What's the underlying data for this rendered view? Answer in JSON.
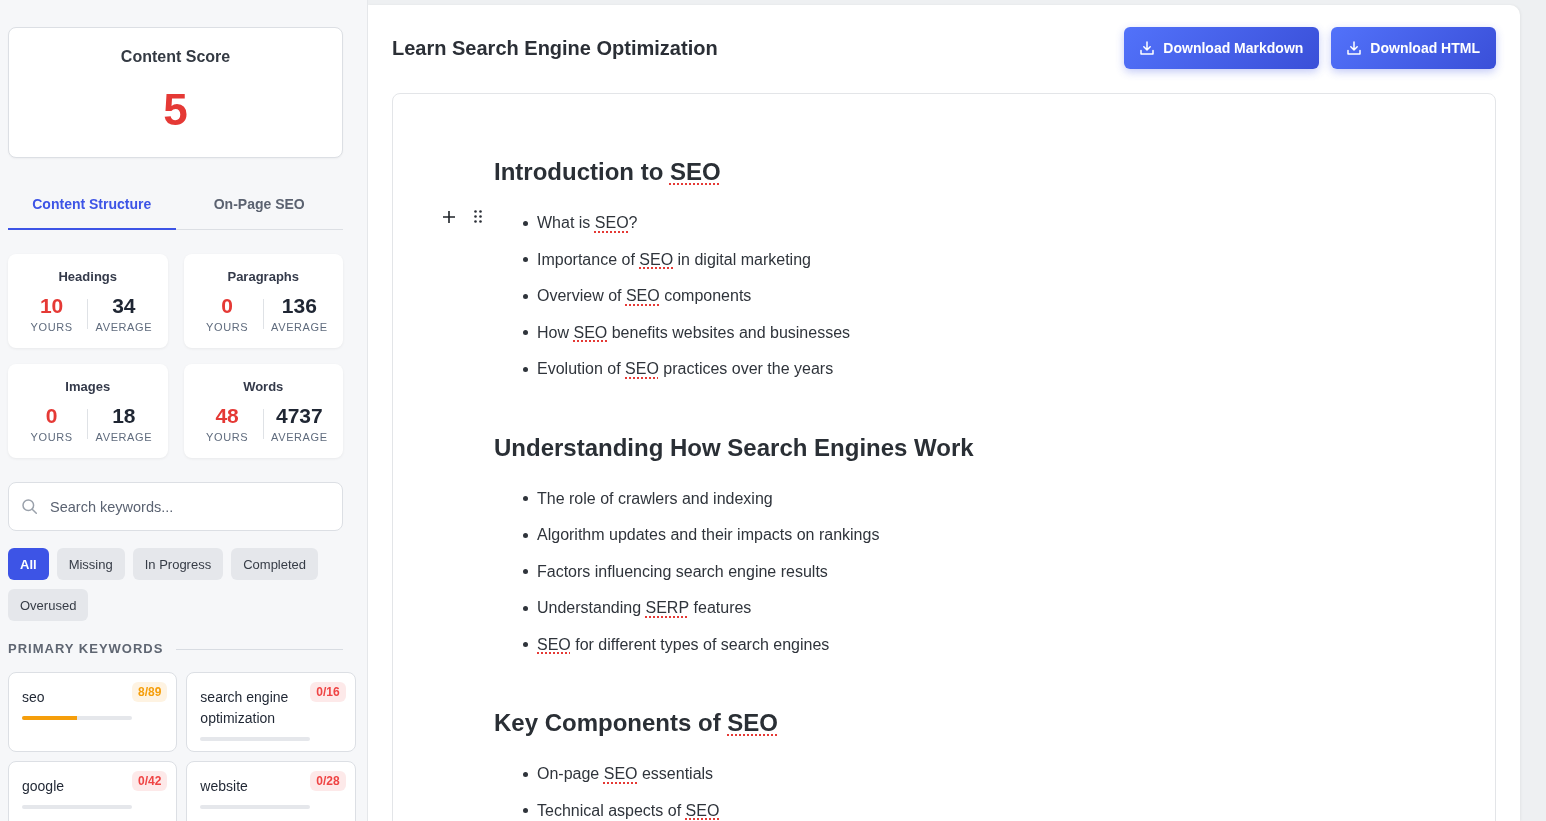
{
  "sidebar": {
    "content_score": {
      "label": "Content Score",
      "value": "5"
    },
    "tabs": [
      {
        "label": "Content Structure",
        "selected": true
      },
      {
        "label": "On-Page SEO",
        "selected": false
      }
    ],
    "stats": [
      {
        "title": "Headings",
        "yours": "10",
        "yours_label": "YOURS",
        "average": "34",
        "average_label": "AVERAGE"
      },
      {
        "title": "Paragraphs",
        "yours": "0",
        "yours_label": "YOURS",
        "average": "136",
        "average_label": "AVERAGE"
      },
      {
        "title": "Images",
        "yours": "0",
        "yours_label": "YOURS",
        "average": "18",
        "average_label": "AVERAGE"
      },
      {
        "title": "Words",
        "yours": "48",
        "yours_label": "YOURS",
        "average": "4737",
        "average_label": "AVERAGE"
      }
    ],
    "search": {
      "placeholder": "Search keywords..."
    },
    "filters": [
      {
        "label": "All",
        "selected": true
      },
      {
        "label": "Missing",
        "selected": false
      },
      {
        "label": "In Progress",
        "selected": false
      },
      {
        "label": "Completed",
        "selected": false
      },
      {
        "label": "Overused",
        "selected": false
      }
    ],
    "primary_keywords": {
      "title": "PRIMARY KEYWORDS",
      "items": [
        {
          "keyword": "seo",
          "count": "8/89",
          "color": "#f59e0b",
          "level": 0.5
        },
        {
          "keyword": "search engine optimization",
          "count": "0/16",
          "color": "#ef4444"
        },
        {
          "keyword": "google",
          "count": "0/42",
          "color": "#ef4444"
        },
        {
          "keyword": "website",
          "count": "0/28",
          "color": "#ef4444"
        }
      ]
    }
  },
  "document": {
    "title": "Learn Search Engine Optimization",
    "buttons": [
      "Download Markdown",
      "Download HTML"
    ],
    "sections": [
      {
        "hovered": true,
        "heading": {
          "segments": [
            {
              "text": "Introduction to ",
              "flagged": false
            },
            {
              "text": "SEO",
              "flagged": true
            }
          ]
        },
        "items": [
          {
            "segments": [
              {
                "text": "What is ",
                "flagged": false
              },
              {
                "text": "SEO",
                "flagged": true
              },
              {
                "text": "?",
                "flagged": false
              }
            ]
          },
          {
            "segments": [
              {
                "text": "Importance of ",
                "flagged": false
              },
              {
                "text": "SEO",
                "flagged": true
              },
              {
                "text": " in digital marketing",
                "flagged": false
              }
            ]
          },
          {
            "segments": [
              {
                "text": "Overview of ",
                "flagged": false
              },
              {
                "text": "SEO",
                "flagged": true
              },
              {
                "text": " components",
                "flagged": false
              }
            ]
          },
          {
            "segments": [
              {
                "text": "How ",
                "flagged": false
              },
              {
                "text": "SEO",
                "flagged": true
              },
              {
                "text": " benefits websites and businesses",
                "flagged": false
              }
            ]
          },
          {
            "segments": [
              {
                "text": "Evolution of ",
                "flagged": false
              },
              {
                "text": "SEO",
                "flagged": true
              },
              {
                "text": " practices over the years",
                "flagged": false
              }
            ]
          }
        ]
      },
      {
        "hovered": false,
        "heading": {
          "segments": [
            {
              "text": "Understanding How Search Engines Work",
              "flagged": false
            }
          ]
        },
        "items": [
          {
            "segments": [
              {
                "text": "The role of crawlers and indexing",
                "flagged": false
              }
            ]
          },
          {
            "segments": [
              {
                "text": "Algorithm updates and their impacts on rankings",
                "flagged": false
              }
            ]
          },
          {
            "segments": [
              {
                "text": "Factors influencing search engine results",
                "flagged": false
              }
            ]
          },
          {
            "segments": [
              {
                "text": "Understanding ",
                "flagged": false
              },
              {
                "text": "SERP",
                "flagged": true
              },
              {
                "text": " features",
                "flagged": false
              }
            ]
          },
          {
            "segments": [
              {
                "text": "SEO",
                "flagged": true
              },
              {
                "text": " for different types of search engines",
                "flagged": false
              }
            ]
          }
        ]
      },
      {
        "hovered": false,
        "heading": {
          "segments": [
            {
              "text": "Key Components of ",
              "flagged": false
            },
            {
              "text": "SEO",
              "flagged": true
            }
          ]
        },
        "items": [
          {
            "segments": [
              {
                "text": "On-page ",
                "flagged": false
              },
              {
                "text": "SEO",
                "flagged": true
              },
              {
                "text": " essentials",
                "flagged": false
              }
            ]
          },
          {
            "segments": [
              {
                "text": "Technical aspects of ",
                "flagged": false
              },
              {
                "text": "SEO",
                "flagged": true
              }
            ]
          }
        ]
      }
    ]
  }
}
